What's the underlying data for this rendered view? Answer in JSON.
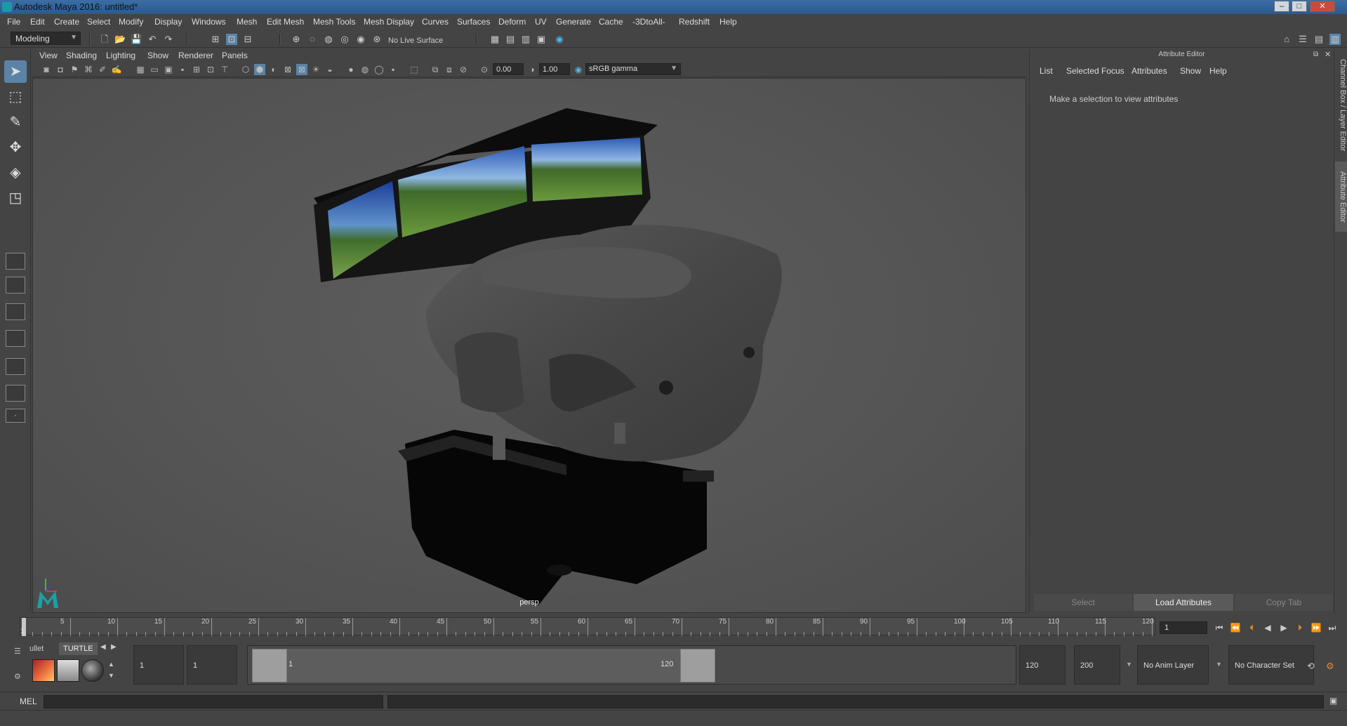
{
  "window": {
    "title": "Autodesk Maya 2016: untitled*"
  },
  "menus": [
    "File",
    "Edit",
    "Create",
    "Select",
    "Modify",
    "Display",
    "Windows",
    "Mesh",
    "Edit Mesh",
    "Mesh Tools",
    "Mesh Display",
    "Curves",
    "Surfaces",
    "Deform",
    "UV",
    "Generate",
    "Cache",
    "-3DtoAll-",
    "Redshift",
    "Help"
  ],
  "statusline": {
    "mode": "Modeling",
    "live_surface": "No Live Surface"
  },
  "panel": {
    "menus": [
      "View",
      "Shading",
      "Lighting",
      "Show",
      "Renderer",
      "Panels"
    ],
    "exposure": "0.00",
    "gamma": "1.00",
    "color_space": "sRGB gamma",
    "camera_label": "persp"
  },
  "attribute_editor": {
    "title": "Attribute Editor",
    "menus": [
      "List",
      "Selected",
      "Focus",
      "Attributes",
      "Show",
      "Help"
    ],
    "message": "Make a selection to view attributes",
    "buttons": {
      "select": "Select",
      "load": "Load Attributes",
      "copy": "Copy Tab"
    }
  },
  "side_tabs": {
    "channel_box": "Channel Box / Layer Editor",
    "attribute_editor": "Attribute Editor"
  },
  "timeline": {
    "tick_labels": [
      "5",
      "10",
      "15",
      "20",
      "25",
      "30",
      "35",
      "40",
      "45",
      "50",
      "55",
      "60",
      "65",
      "70",
      "75",
      "80",
      "85",
      "90",
      "95",
      "100",
      "105",
      "110",
      "115",
      "120"
    ],
    "start_marker": "1",
    "current_frame": "1"
  },
  "shelf": {
    "tabs": [
      "ullet",
      "TURTLE"
    ]
  },
  "range": {
    "start": "1",
    "playback_start": "1",
    "range_start_label": "1",
    "range_end_label": "120",
    "playback_end": "120",
    "end": "200",
    "anim_layer": "No Anim Layer",
    "character_set": "No Character Set"
  },
  "command_line": {
    "language": "MEL"
  },
  "icons": {
    "select_tool": "arrow-pointer-icon",
    "lasso_tool": "lasso-icon",
    "paint_tool": "paint-brush-icon",
    "move_tool": "move-icon",
    "rotate_tool": "rotate-icon",
    "scale_tool": "scale-icon"
  }
}
